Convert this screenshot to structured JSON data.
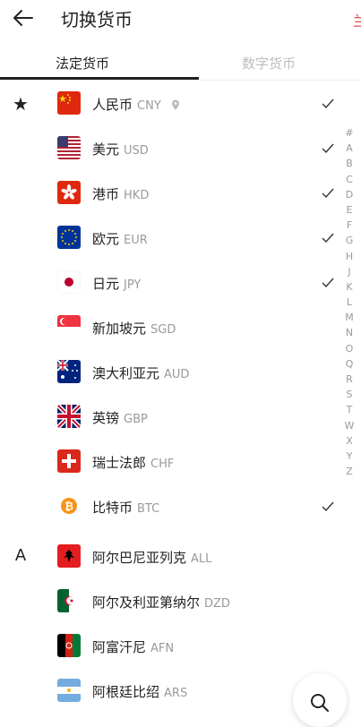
{
  "header": {
    "title": "切换货币",
    "edge_char": "兰"
  },
  "tabs": [
    {
      "label": "法定货币",
      "active": true
    },
    {
      "label": "数字货币",
      "active": false
    }
  ],
  "sections": {
    "favorites_mark": "★",
    "a_mark": "A"
  },
  "currencies": [
    {
      "name": "人民币",
      "code": "CNY",
      "checked": true,
      "location_icon": true
    },
    {
      "name": "美元",
      "code": "USD",
      "checked": true
    },
    {
      "name": "港币",
      "code": "HKD",
      "checked": true
    },
    {
      "name": "欧元",
      "code": "EUR",
      "checked": true
    },
    {
      "name": "日元",
      "code": "JPY",
      "checked": true
    },
    {
      "name": "新加坡元",
      "code": "SGD",
      "checked": false
    },
    {
      "name": "澳大利亚元",
      "code": "AUD",
      "checked": false
    },
    {
      "name": "英镑",
      "code": "GBP",
      "checked": false
    },
    {
      "name": "瑞士法郎",
      "code": "CHF",
      "checked": false
    },
    {
      "name": "比特币",
      "code": "BTC",
      "checked": true
    },
    {
      "name": "阿尔巴尼亚列克",
      "code": "ALL",
      "checked": false
    },
    {
      "name": "阿尔及利亚第纳尔",
      "code": "DZD",
      "checked": false
    },
    {
      "name": "阿富汗尼",
      "code": "AFN",
      "checked": false
    },
    {
      "name": "阿根廷比绍",
      "code": "ARS",
      "checked": false
    }
  ],
  "index_letters": [
    "#",
    "A",
    "B",
    "C",
    "D",
    "E",
    "F",
    "G",
    "H",
    "J",
    "K",
    "L",
    "M",
    "N",
    "O",
    "Q",
    "R",
    "S",
    "T",
    "W",
    "X",
    "Y",
    "Z"
  ],
  "icons": {
    "back": "arrow-left-icon",
    "check": "check-icon",
    "search": "search-icon",
    "location": "location-pin-icon"
  },
  "colors": {
    "active_tab": "#222222",
    "inactive_tab": "#bdbdbd",
    "code_text": "#9a9a9a"
  }
}
